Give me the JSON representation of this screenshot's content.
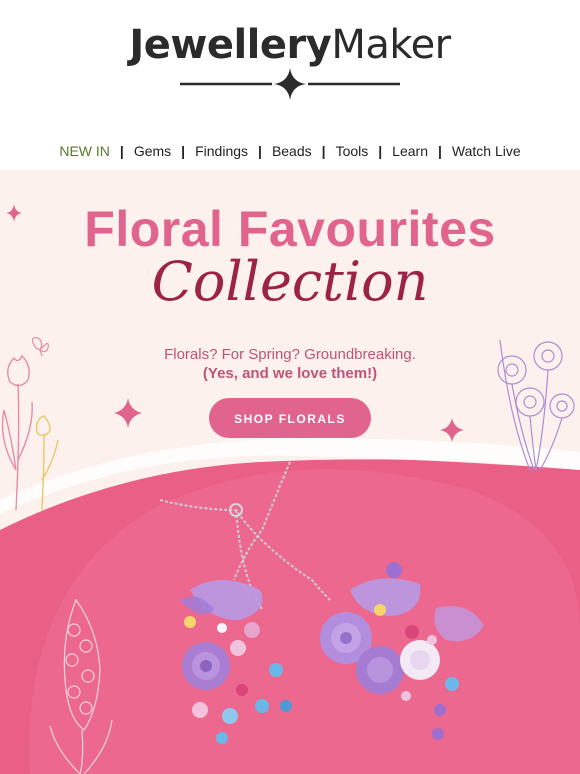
{
  "brand": {
    "logo_bold": "Jewellery",
    "logo_regular": "Maker"
  },
  "nav": [
    "NEW IN",
    "Gems",
    "Findings",
    "Beads",
    "Tools",
    "Learn",
    "Watch Live"
  ],
  "nav_separator": "|",
  "hero": {
    "title_line1": "Floral Favourites",
    "title_line2": "Collection",
    "subtitle": "Florals? For Spring? Groundbreaking.",
    "subtitle_emphasis": "(Yes, and we love them!)",
    "cta_label": "SHOP FLORALS"
  },
  "colors": {
    "pink": "#e0648e",
    "deep_pink": "#9c2346",
    "cream": "#fcf1ec",
    "nav_new": "#5a7a2e",
    "photo_pink": "#e95f86",
    "lilac": "#b08ad6"
  },
  "icons": [
    "sparkle-icon",
    "butterfly-icon",
    "tulip-illustration",
    "daffodil-illustration",
    "hyacinth-illustration"
  ]
}
